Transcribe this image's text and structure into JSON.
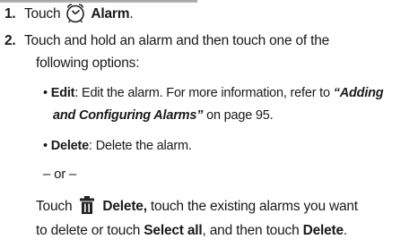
{
  "step1": {
    "number": "1.",
    "text_prefix": "Touch",
    "icon": "alarm-clock-icon",
    "label": "Alarm",
    "suffix": "."
  },
  "step2": {
    "number": "2.",
    "line1": "Touch and hold an alarm and then touch one of the",
    "line2": "following options:"
  },
  "bullets": {
    "edit": {
      "label": "Edit",
      "text": ": Edit the alarm. For more information, refer to ",
      "ref": "“Adding",
      "ref2": "and Configuring Alarms”",
      "page_ref": " on page 95."
    },
    "delete": {
      "label": "Delete",
      "text": ": Delete the alarm."
    }
  },
  "or_text": "– or –",
  "touch_delete": {
    "prefix": "Touch",
    "icon": "trash-icon",
    "label": "Delete,",
    "rest": " touch the existing alarms you want",
    "line2_prefix": "to delete or touch ",
    "select_all": "Select all",
    "mid": ", and then touch ",
    "delete_label": "Delete",
    "end": "."
  }
}
